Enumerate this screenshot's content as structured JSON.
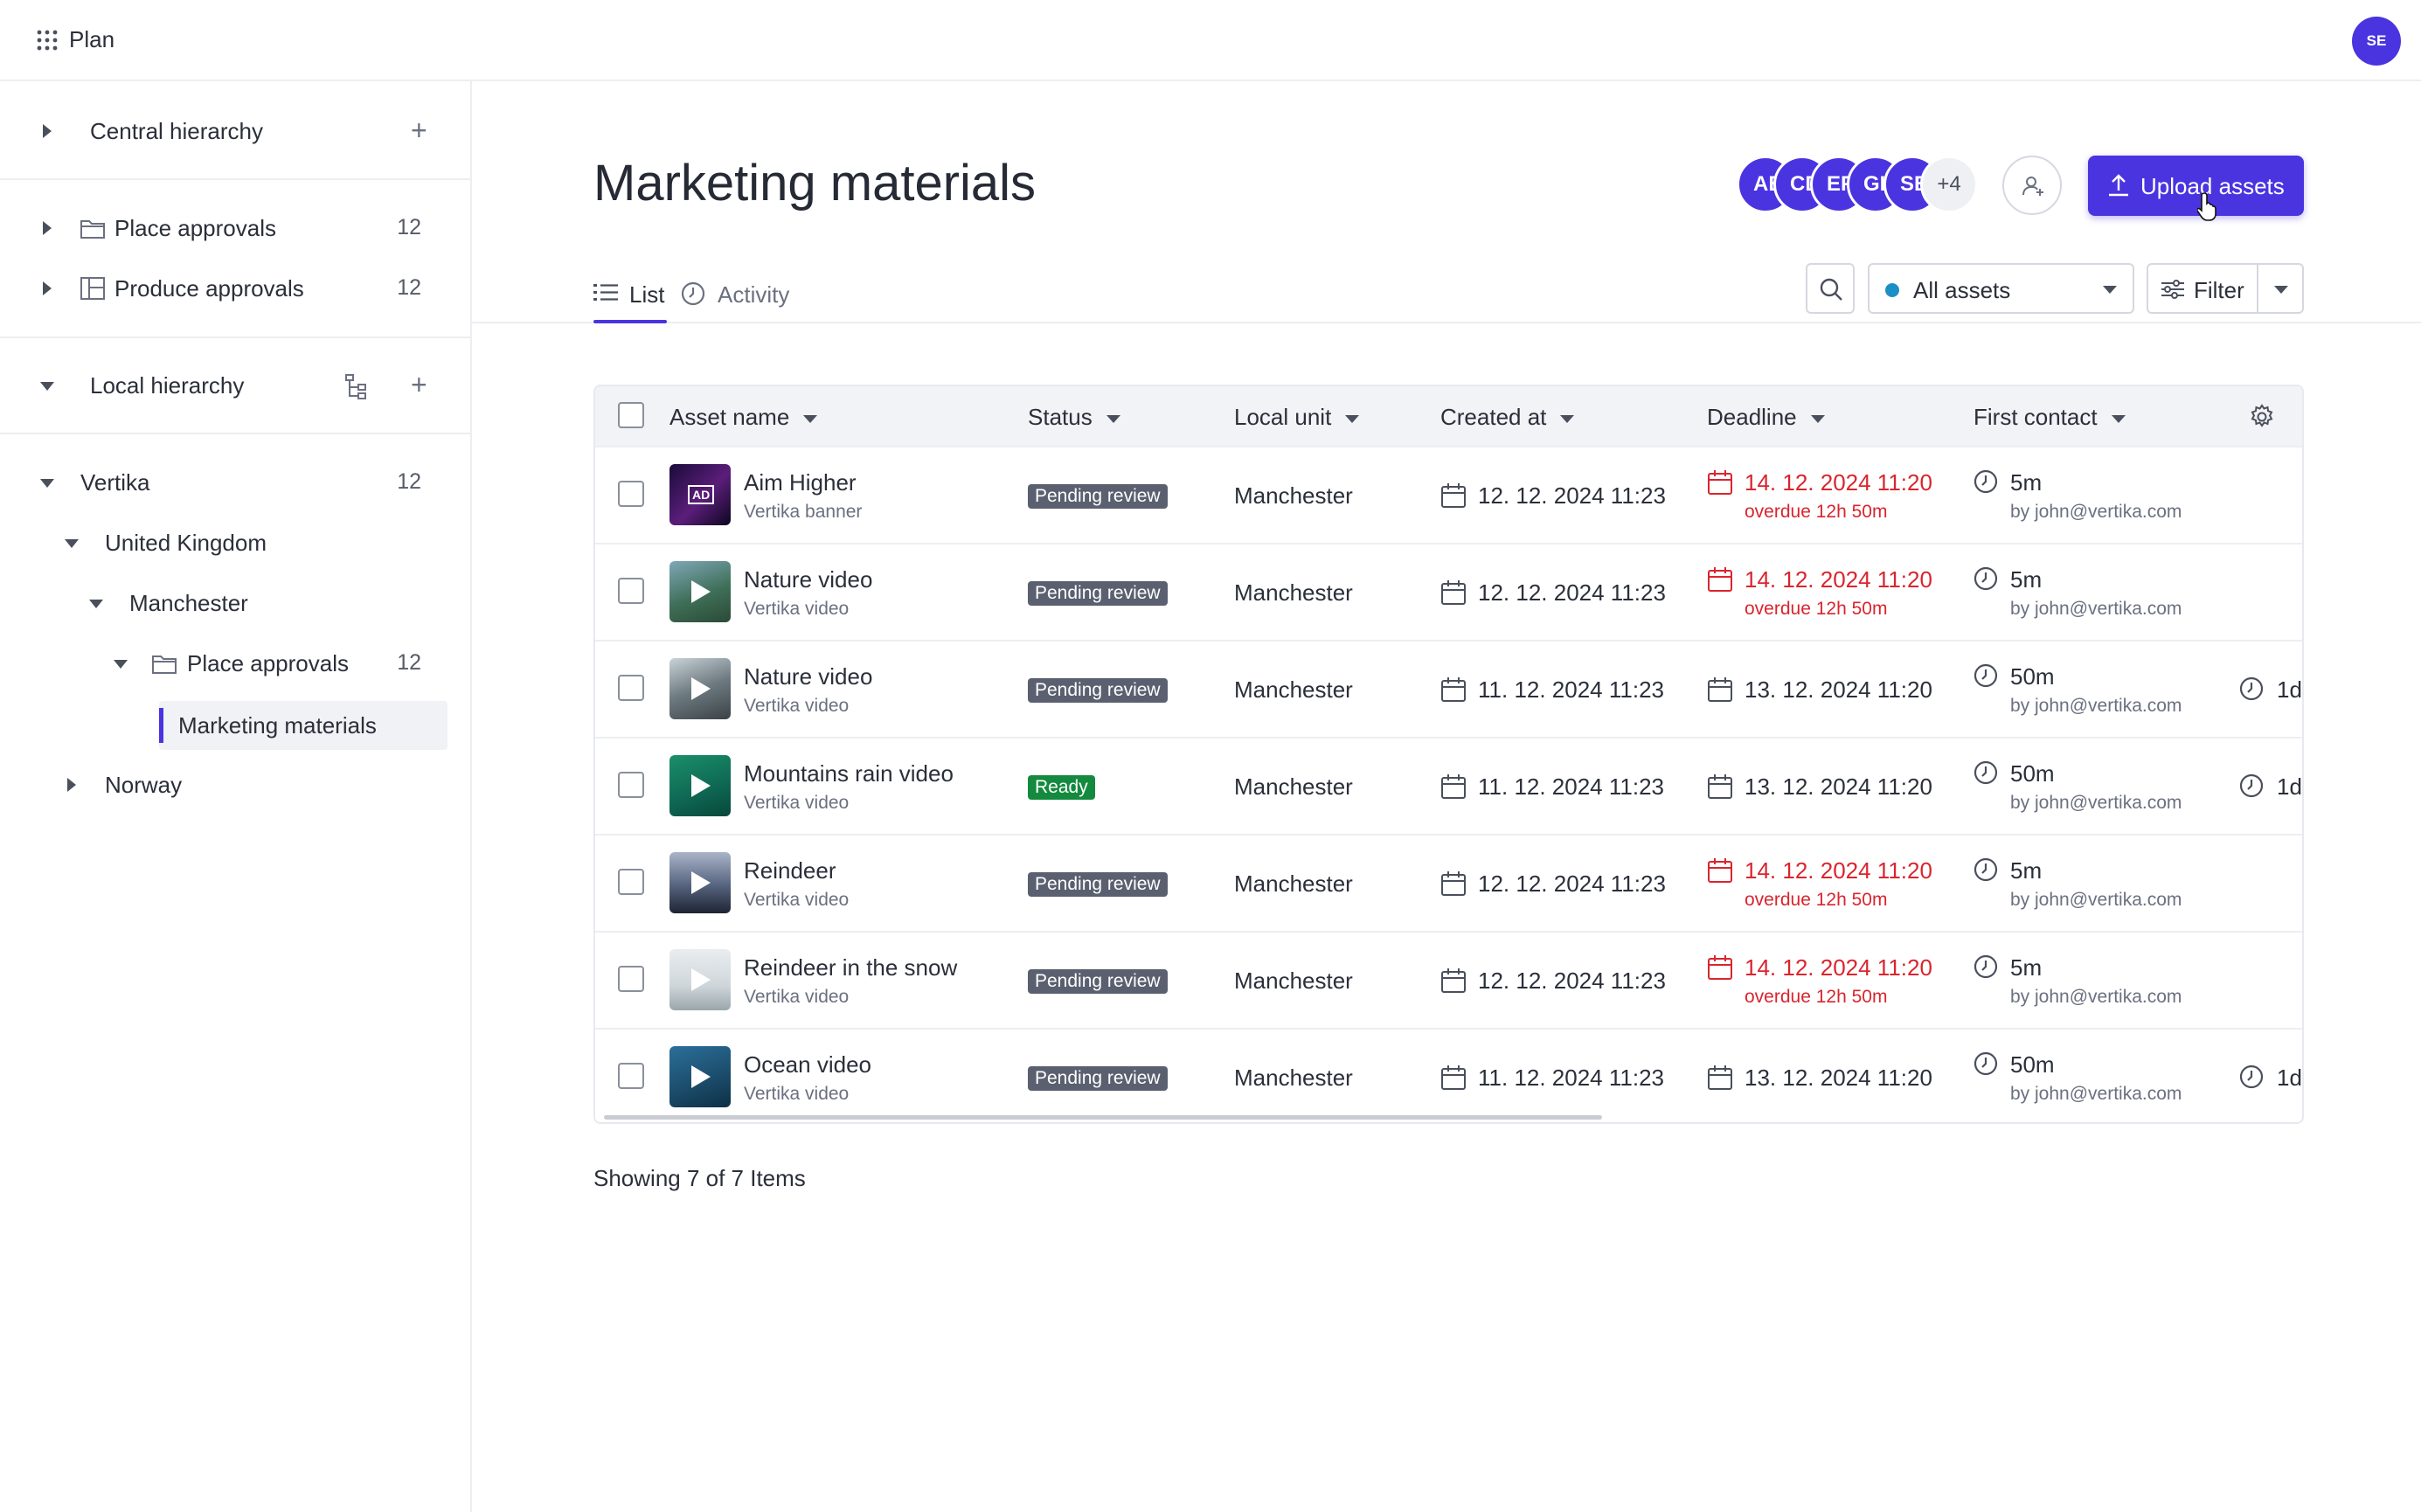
{
  "app": {
    "name": "Plan",
    "user_initials": "SE"
  },
  "sidebar": {
    "central": {
      "label": "Central hierarchy"
    },
    "items_top": [
      {
        "label": "Place approvals",
        "count": "12"
      },
      {
        "label": "Produce approvals",
        "count": "12"
      }
    ],
    "local": {
      "label": "Local hierarchy"
    },
    "tree": {
      "root": {
        "label": "Vertika",
        "count": "12"
      },
      "country": {
        "label": "United Kingdom"
      },
      "city": {
        "label": "Manchester"
      },
      "folder": {
        "label": "Place approvals",
        "count": "12"
      },
      "active": {
        "label": "Marketing materials"
      },
      "other": {
        "label": "Norway"
      }
    }
  },
  "page": {
    "title": "Marketing materials",
    "collaborators": [
      "AE",
      "CD",
      "EF",
      "GH",
      "SE"
    ],
    "more_count": "+4",
    "upload_label": "Upload assets",
    "tabs": [
      {
        "label": "List",
        "active": true
      },
      {
        "label": "Activity",
        "active": false
      }
    ],
    "assets_select": "All assets",
    "filter_label": "Filter"
  },
  "table": {
    "headers": {
      "asset_name": "Asset name",
      "status": "Status",
      "local_unit": "Local unit",
      "created_at": "Created at",
      "deadline": "Deadline",
      "first_contact": "First contact"
    },
    "rows": [
      {
        "name": "Aim Higher",
        "sub": "Vertika banner",
        "status": "Pending review",
        "unit": "Manchester",
        "created": "12. 12. 2024 11:23",
        "deadline": "14. 12. 2024 11:20",
        "overdue": "overdue 12h 50m",
        "fc": "5m",
        "fc_by": "by john@vertika.com",
        "extra": ""
      },
      {
        "name": "Nature video",
        "sub": "Vertika video",
        "status": "Pending review",
        "unit": "Manchester",
        "created": "12. 12. 2024 11:23",
        "deadline": "14. 12. 2024 11:20",
        "overdue": "overdue 12h 50m",
        "fc": "5m",
        "fc_by": "by john@vertika.com",
        "extra": ""
      },
      {
        "name": "Nature video",
        "sub": "Vertika video",
        "status": "Pending review",
        "unit": "Manchester",
        "created": "11. 12. 2024 11:23",
        "deadline": "13. 12. 2024 11:20",
        "overdue": "",
        "fc": "50m",
        "fc_by": "by john@vertika.com",
        "extra": "1d"
      },
      {
        "name": "Mountains rain video",
        "sub": "Vertika video",
        "status": "Ready",
        "unit": "Manchester",
        "created": "11. 12. 2024 11:23",
        "deadline": "13. 12. 2024 11:20",
        "overdue": "",
        "fc": "50m",
        "fc_by": "by john@vertika.com",
        "extra": "1d"
      },
      {
        "name": "Reindeer",
        "sub": "Vertika video",
        "status": "Pending review",
        "unit": "Manchester",
        "created": "12. 12. 2024 11:23",
        "deadline": "14. 12. 2024 11:20",
        "overdue": "overdue 12h 50m",
        "fc": "5m",
        "fc_by": "by john@vertika.com",
        "extra": ""
      },
      {
        "name": "Reindeer in the snow",
        "sub": "Vertika video",
        "status": "Pending review",
        "unit": "Manchester",
        "created": "12. 12. 2024 11:23",
        "deadline": "14. 12. 2024 11:20",
        "overdue": "overdue 12h 50m",
        "fc": "5m",
        "fc_by": "by john@vertika.com",
        "extra": ""
      },
      {
        "name": "Ocean video",
        "sub": "Vertika video",
        "status": "Pending review",
        "unit": "Manchester",
        "created": "11. 12. 2024 11:23",
        "deadline": "13. 12. 2024 11:20",
        "overdue": "",
        "fc": "50m",
        "fc_by": "by john@vertika.com",
        "extra": "1d"
      }
    ],
    "footer": "Showing 7 of 7 Items"
  },
  "colors": {
    "accent": "#4a34e0",
    "pending_badge": "#5b6070",
    "ready_badge": "#138a3e",
    "overdue": "#d9252e"
  }
}
